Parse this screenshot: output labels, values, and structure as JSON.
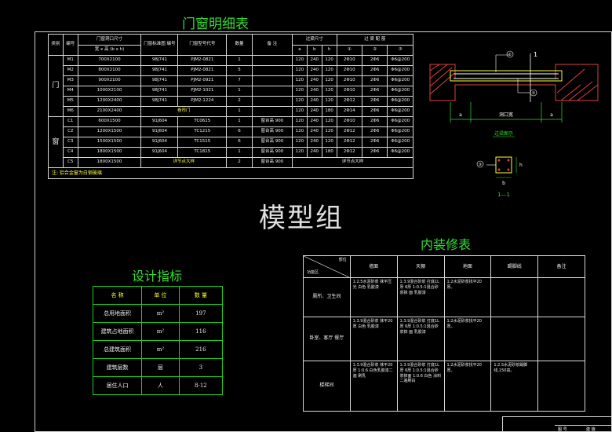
{
  "door_schedule": {
    "title": "门窗明细表",
    "headers": {
      "category": "类别",
      "code": "编号",
      "opening": "门窗洞口尺寸",
      "opening_sub": "宽 x 高 (b x h)",
      "atlas": "门窗标准图 编号",
      "model": "门窗型号代号",
      "qty": "数量",
      "remark": "备 注",
      "lintel": "过梁尺寸",
      "a": "a",
      "b": "b",
      "h": "h",
      "rebar": "过 梁 配 筋",
      "c1": "①",
      "c2": "②",
      "c3": "③"
    },
    "door_label": "门",
    "window_label": "窗",
    "door_rows": [
      {
        "code": "M1",
        "size": "700X2100",
        "atlas": "98J741",
        "model": "PJM2-0821",
        "qty": "1",
        "remark": "",
        "a": "120",
        "b": "240",
        "h": "120",
        "r1": "2Φ10",
        "r2": "2Φ6",
        "r3": "Φ6@200"
      },
      {
        "code": "M2",
        "size": "800X2100",
        "atlas": "98J741",
        "model": "PJM2-0821",
        "qty": "5",
        "remark": "",
        "a": "120",
        "b": "240",
        "h": "120",
        "r1": "2Φ10",
        "r2": "2Φ6",
        "r3": "Φ6@200"
      },
      {
        "code": "M3",
        "size": "900X2100",
        "atlas": "98J741",
        "model": "PJM2-0921",
        "qty": "7",
        "remark": "",
        "a": "120",
        "b": "240",
        "h": "120",
        "r1": "2Φ10",
        "r2": "2Φ6",
        "r3": "Φ6@200"
      },
      {
        "code": "M4",
        "size": "1000X2100",
        "atlas": "98J741",
        "model": "PJM2-1021",
        "qty": "1",
        "remark": "",
        "a": "120",
        "b": "240",
        "h": "120",
        "r1": "2Φ10",
        "r2": "2Φ6",
        "r3": "Φ6@200"
      },
      {
        "code": "M5",
        "size": "1200X2400",
        "atlas": "98J741",
        "model": "PJM2-1224",
        "qty": "2",
        "remark": "",
        "a": "120",
        "b": "240",
        "h": "120",
        "r1": "2Φ12",
        "r2": "2Φ6",
        "r3": "Φ6@200"
      },
      {
        "code": "M6",
        "size": "2100X2400",
        "atlas": "",
        "model": "",
        "special": "卷帘门",
        "qty": "1",
        "remark": "",
        "a": "120",
        "b": "240",
        "h": "180",
        "r1": "2Φ14",
        "r2": "2Φ6",
        "r3": "Φ6@200"
      }
    ],
    "window_rows": [
      {
        "code": "C1",
        "size": "600X1500",
        "atlas": "91J604",
        "model": "TC0615",
        "qty": "1",
        "remark": "窗台高 900",
        "a": "120",
        "b": "240",
        "h": "120",
        "r1": "2Φ10",
        "r2": "2Φ6",
        "r3": "Φ6@200"
      },
      {
        "code": "C2",
        "size": "1200X1500",
        "atlas": "91J604",
        "model": "TC1215",
        "qty": "6",
        "remark": "窗台高 900",
        "a": "120",
        "b": "240",
        "h": "120",
        "r1": "2Φ12",
        "r2": "2Φ6",
        "r3": "Φ6@200"
      },
      {
        "code": "C3",
        "size": "1500X1500",
        "atlas": "91J604",
        "model": "TC1515",
        "qty": "6",
        "remark": "窗台高 900",
        "a": "120",
        "b": "240",
        "h": "120",
        "r1": "2Φ12",
        "r2": "2Φ6",
        "r3": "Φ6@200"
      },
      {
        "code": "C4",
        "size": "1800X1500",
        "atlas": "91J604",
        "model": "TC1815",
        "qty": "1",
        "remark": "窗台高 900",
        "a": "120",
        "b": "240",
        "h": "180",
        "r1": "2Φ12",
        "r2": "2Φ6",
        "r3": "Φ6@200"
      },
      {
        "code": "C5",
        "size": "1800X1500",
        "atlas": "",
        "model": "",
        "special": "详节点大样",
        "qty": "2",
        "remark": "窗台高 900",
        "a": "",
        "b": "",
        "h": "",
        "span": "详节点大样"
      }
    ],
    "note": "注: 铝合金窗为白钢玻璃"
  },
  "lintel_detail": {
    "top_label": "1",
    "circle1": "①",
    "circle2": "②",
    "dim_a_left": "a",
    "dim_opening": "洞口宽",
    "dim_a_right": "a",
    "caption": "过梁图示",
    "section_circle": "③",
    "dim_h": "h",
    "dim_b": "b",
    "section_label": "1—1"
  },
  "design_index": {
    "title": "设计指标",
    "headers": [
      "名 称",
      "单 位",
      "数 量"
    ],
    "rows": [
      [
        "总用地面积",
        "m²",
        "197"
      ],
      [
        "建筑占地面积",
        "m²",
        "116"
      ],
      [
        "总建筑面积",
        "m²",
        "216"
      ],
      [
        "建筑层数",
        "层",
        "3"
      ],
      [
        "居住人口",
        "人",
        "8-12"
      ]
    ]
  },
  "interior": {
    "title": "内装修表",
    "corner_top": "部位",
    "corner_bottom": "功能区",
    "headers": [
      "墙面",
      "天棚",
      "地面",
      "踢脚线",
      "备注"
    ],
    "rows": [
      {
        "area": "厕所、卫生间",
        "wall": "1:2.5水泥砂浆 抹平压光 白色 乳胶漆",
        "ceiling": "1:3.9混合砂浆 打底1L厚 6厚 1:0.5:1混合砂 浆抹 面 乳胶漆",
        "floor": "1:2水泥砂浆找平20厚。",
        "skirting": "",
        "remark": ""
      },
      {
        "area": "卧室、客厅 餐厅",
        "wall": "1:3.9混合砂浆 抹平20厚 白色 乳胶漆",
        "ceiling": "1:3.9混合砂浆 打底1L厚 6厚 1:0.5:1混合砂 浆抹 面 乳胶漆",
        "floor": "1:2水泥砂浆找平20厚。",
        "skirting": "",
        "remark": ""
      },
      {
        "area": "楼梯间",
        "wall": "1:3.9混合砂浆 抹平20厚 1:0.6 白色乳胶漆二遍 刷乳",
        "ceiling": "1:3.9混合砂浆 打底1L厚 6厚 1:0.5:1混合砂 浆抹面 1:0.6 白色 涂料二遍刷白",
        "floor": "1:2水泥砂浆找平20厚。",
        "skirting": "1:2.5水泥砂浆踢脚线,150高。",
        "remark": ""
      }
    ]
  },
  "watermark": "模型组",
  "title_block": {
    "c1": "图 号",
    "c2": "建 施"
  }
}
